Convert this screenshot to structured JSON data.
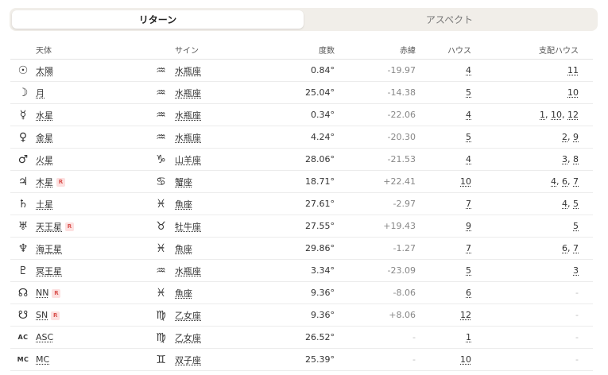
{
  "tabs": [
    {
      "label": "リターン",
      "active": true
    },
    {
      "label": "アスペクト",
      "active": false
    }
  ],
  "headers": {
    "body": "天体",
    "sign": "サイン",
    "degree": "度数",
    "declination": "赤緯",
    "house": "ハウス",
    "rules": "支配ハウス"
  },
  "rows": [
    {
      "symbol": "☉",
      "name": "太陽",
      "retro": false,
      "signSymbol": "♒",
      "sign": "水瓶座",
      "degree": "0.84°",
      "declination": "-19.97",
      "house": "4",
      "rules": [
        "11"
      ]
    },
    {
      "symbol": "☽",
      "name": "月",
      "retro": false,
      "signSymbol": "♒",
      "sign": "水瓶座",
      "degree": "25.04°",
      "declination": "-14.38",
      "house": "5",
      "rules": [
        "10"
      ]
    },
    {
      "symbol": "☿",
      "name": "水星",
      "retro": false,
      "signSymbol": "♒",
      "sign": "水瓶座",
      "degree": "0.34°",
      "declination": "-22.06",
      "house": "4",
      "rules": [
        "1",
        "10",
        "12"
      ]
    },
    {
      "symbol": "♀",
      "name": "金星",
      "retro": false,
      "signSymbol": "♒",
      "sign": "水瓶座",
      "degree": "4.24°",
      "declination": "-20.30",
      "house": "5",
      "rules": [
        "2",
        "9"
      ]
    },
    {
      "symbol": "♂",
      "name": "火星",
      "retro": false,
      "signSymbol": "♑",
      "sign": "山羊座",
      "degree": "28.06°",
      "declination": "-21.53",
      "house": "4",
      "rules": [
        "3",
        "8"
      ]
    },
    {
      "symbol": "♃",
      "name": "木星",
      "retro": true,
      "signSymbol": "♋",
      "sign": "蟹座",
      "degree": "18.71°",
      "declination": "+22.41",
      "house": "10",
      "rules": [
        "4",
        "6",
        "7"
      ]
    },
    {
      "symbol": "♄",
      "name": "土星",
      "retro": false,
      "signSymbol": "♓",
      "sign": "魚座",
      "degree": "27.61°",
      "declination": "-2.97",
      "house": "7",
      "rules": [
        "4",
        "5"
      ]
    },
    {
      "symbol": "♅",
      "name": "天王星",
      "retro": true,
      "signSymbol": "♉",
      "sign": "牡牛座",
      "degree": "27.55°",
      "declination": "+19.43",
      "house": "9",
      "rules": [
        "5"
      ]
    },
    {
      "symbol": "♆",
      "name": "海王星",
      "retro": false,
      "signSymbol": "♓",
      "sign": "魚座",
      "degree": "29.86°",
      "declination": "-1.27",
      "house": "7",
      "rules": [
        "6",
        "7"
      ]
    },
    {
      "symbol": "♇",
      "name": "冥王星",
      "retro": false,
      "signSymbol": "♒",
      "sign": "水瓶座",
      "degree": "3.34°",
      "declination": "-23.09",
      "house": "5",
      "rules": [
        "3"
      ]
    },
    {
      "symbol": "☊",
      "name": "NN",
      "retro": true,
      "signSymbol": "♓",
      "sign": "魚座",
      "degree": "9.36°",
      "declination": "-8.06",
      "house": "6",
      "rules": []
    },
    {
      "symbol": "☋",
      "name": "SN",
      "retro": true,
      "signSymbol": "♍",
      "sign": "乙女座",
      "degree": "9.36°",
      "declination": "+8.06",
      "house": "12",
      "rules": []
    },
    {
      "symbol": "AC",
      "name": "ASC",
      "retro": false,
      "signSymbol": "♍",
      "sign": "乙女座",
      "degree": "26.52°",
      "declination": "-",
      "house": "1",
      "rules": []
    },
    {
      "symbol": "MC",
      "name": "MC",
      "retro": false,
      "signSymbol": "♊",
      "sign": "双子座",
      "degree": "25.39°",
      "declination": "-",
      "house": "10",
      "rules": []
    }
  ],
  "retro_label": "R",
  "empty_value": "-"
}
